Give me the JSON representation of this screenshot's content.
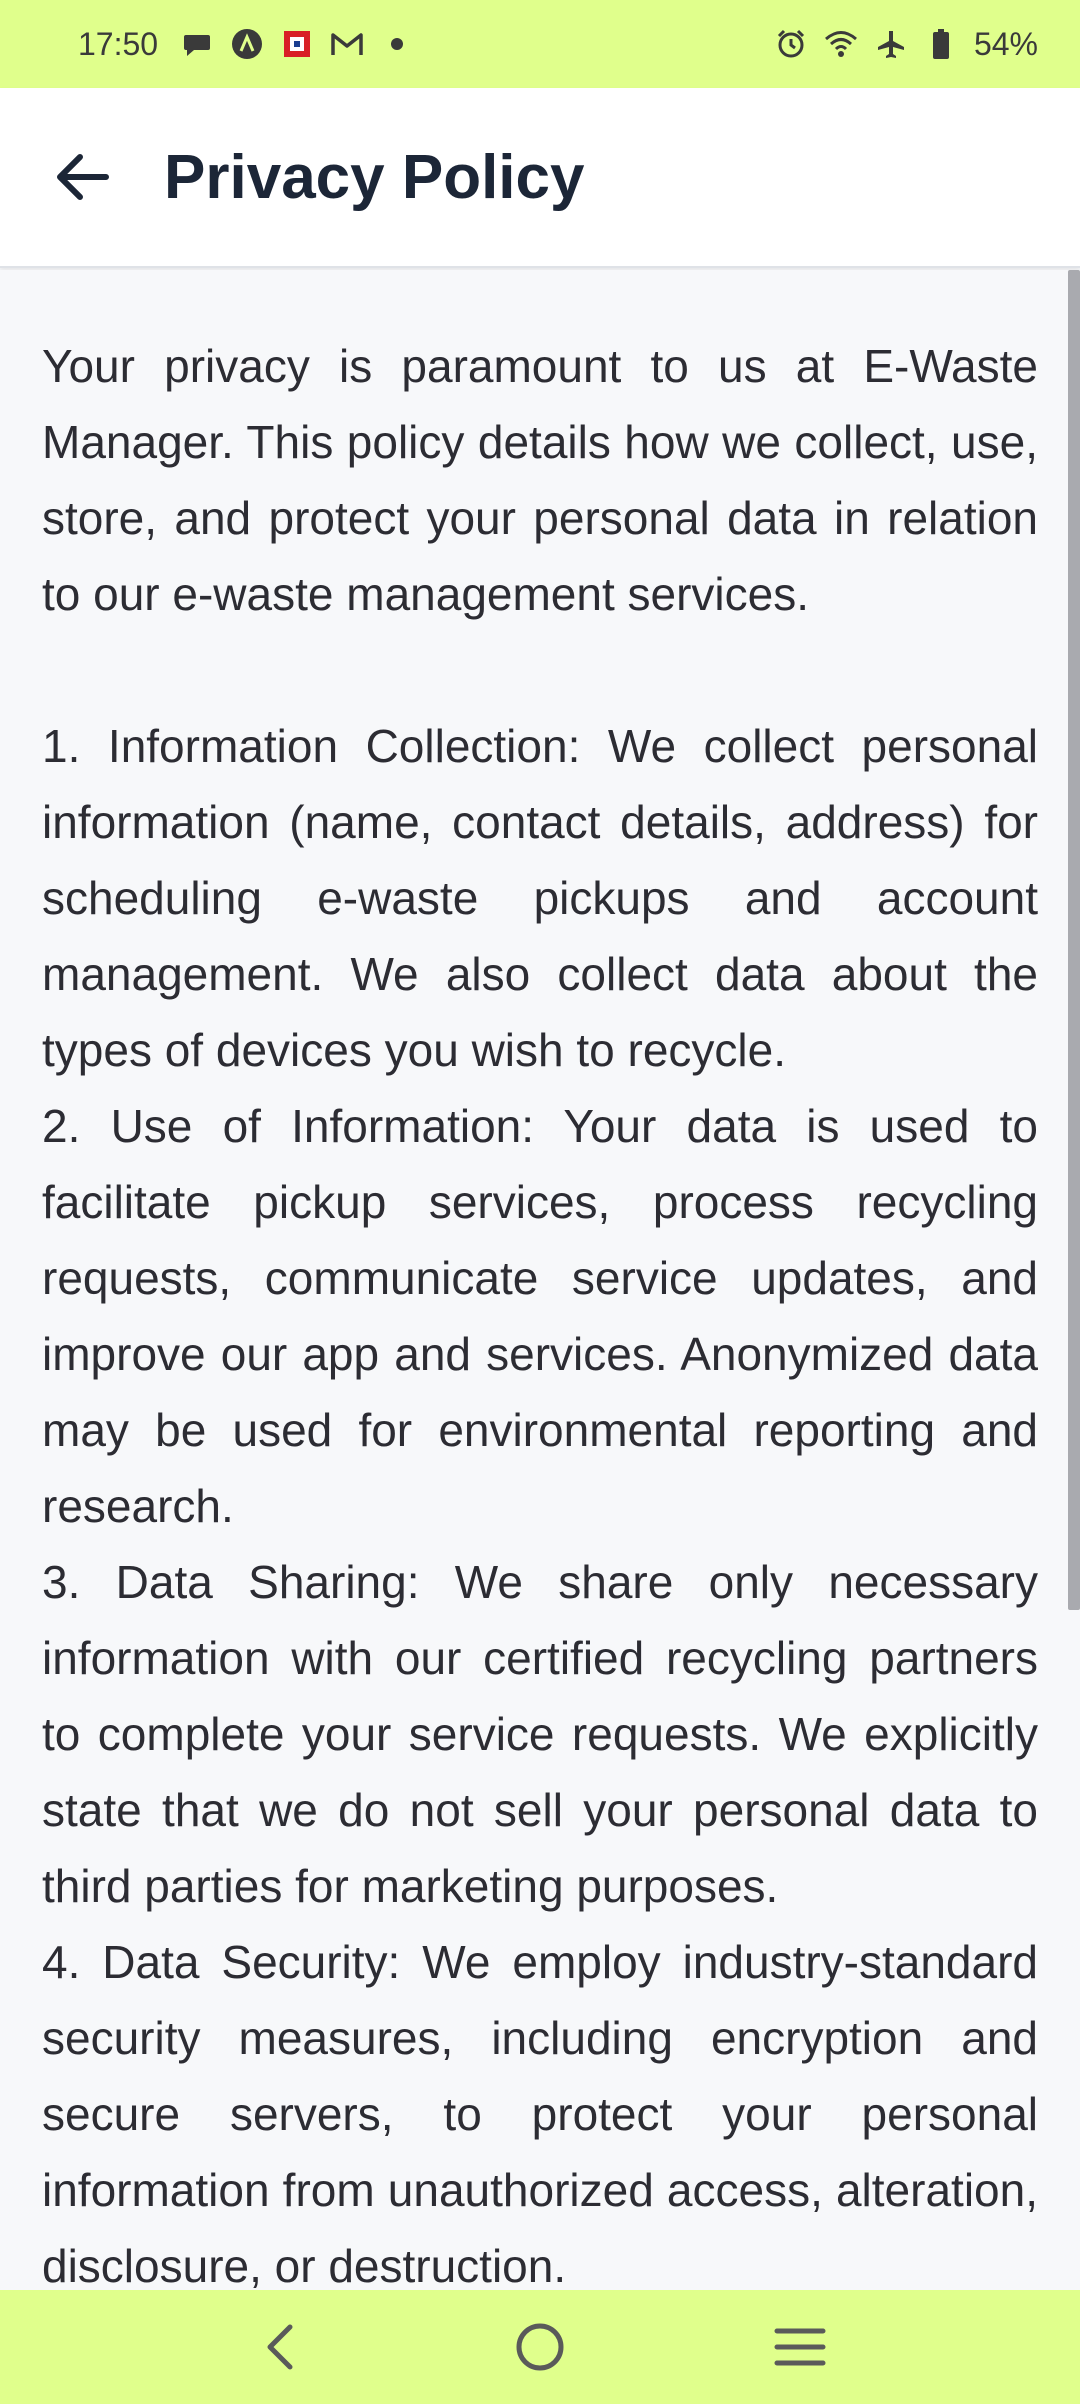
{
  "status_bar": {
    "time": "17:50",
    "battery": "54%",
    "left_icons": [
      "chat-bubble-icon",
      "app-a-icon",
      "red-app-icon",
      "gmail-icon",
      "dot-icon"
    ],
    "right_icons": [
      "alarm-icon",
      "wifi-icon",
      "airplane-icon",
      "battery-icon"
    ],
    "bg_color": "#e0ff8c"
  },
  "app_bar": {
    "title": "Privacy Policy",
    "back_icon": "arrow-left-icon"
  },
  "policy": {
    "intro": "Your privacy is paramount to us at E-Waste Manager. This policy details how we collect, use, store, and protect your personal data in relation to our e-waste management services.",
    "items": [
      "1.  Information Collection: We collect personal information (name, contact details, address) for scheduling e-waste pickups and account management. We also collect data about the types of devices you wish to recycle.",
      "2.  Use of Information: Your data is used to facilitate pickup services, process recycling requests, communicate service updates, and improve our app and services. Anonymized data may be used for environmental reporting and research.",
      "3.  Data Sharing: We share only necessary information with our certified recycling partners to complete your service requests. We explicitly state that we do not sell your personal data to third parties for marketing purposes.",
      "4.  Data Security: We employ industry-standard security measures, including encryption and secure servers, to protect your personal information from unauthorized access, alteration, disclosure, or destruction."
    ]
  },
  "nav_bar": {
    "icons": [
      "nav-back-icon",
      "nav-home-icon",
      "nav-menu-icon"
    ],
    "bg_color": "#e0ff8c"
  }
}
